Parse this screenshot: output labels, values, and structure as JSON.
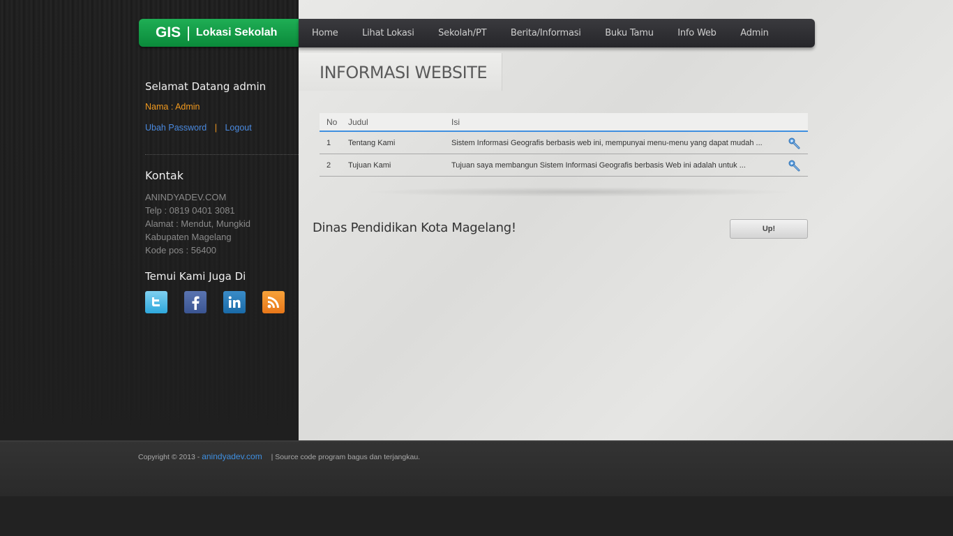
{
  "header": {
    "logo_gis": "GIS",
    "logo_separator": "|",
    "logo_title": "Lokasi Sekolah"
  },
  "nav": {
    "items": [
      "Home",
      "Lihat Lokasi",
      "Sekolah/PT",
      "Berita/Informasi",
      "Buku Tamu",
      "Info Web",
      "Admin"
    ]
  },
  "sidebar": {
    "welcome": "Selamat Datang admin",
    "nama": "Nama : Admin",
    "ubah_password": "Ubah Password",
    "separator": "|",
    "logout": "Logout",
    "kontak_title": "Kontak",
    "kontak_lines": [
      "ANINDYADEV.COM",
      "Telp : 0819 0401 3081",
      "Alamat : Mendut, Mungkid",
      "Kabupaten Magelang",
      "Kode pos : 56400"
    ],
    "social_title": "Temui Kami Juga Di",
    "social_icons": [
      "twitter-icon",
      "facebook-icon",
      "linkedin-icon",
      "rss-icon"
    ]
  },
  "main": {
    "page_title": "INFORMASI WEBSITE",
    "table": {
      "headers": [
        "No",
        "Judul",
        "Isi"
      ],
      "rows": [
        {
          "no": "1",
          "judul": "Tentang Kami",
          "isi": "Sistem Informasi Geografis berbasis web ini, mempunyai menu-menu yang dapat mudah ..."
        },
        {
          "no": "2",
          "judul": "Tujuan Kami",
          "isi": "Tujuan saya membangun Sistem Informasi Geografis berbasis Web ini adalah untuk ..."
        }
      ]
    },
    "footer_note": "Dinas Pendidikan Kota Magelang!",
    "up_button": "Up!"
  },
  "footer": {
    "copyright": "Copyright © 2013 -",
    "link": "anindyadev.com",
    "tagline": "| Source code program bagus dan terjangkau."
  },
  "colors": {
    "brand_green": "#0a8a3a",
    "accent_blue": "#3f8fe0",
    "accent_orange": "#f29a1e"
  }
}
